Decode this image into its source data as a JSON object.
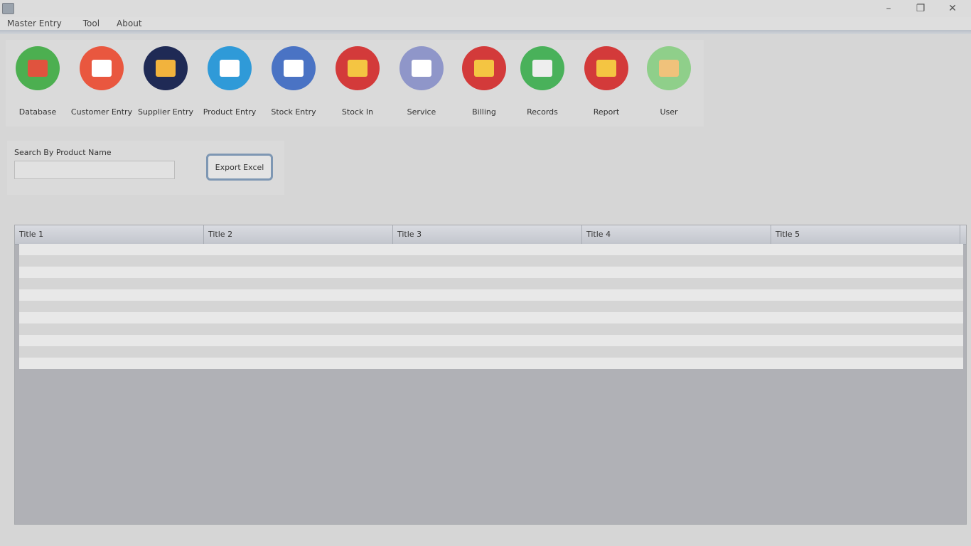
{
  "window": {
    "minimize_glyph": "–",
    "maximize_glyph": "❐",
    "close_glyph": "✕"
  },
  "menu": [
    "Master Entry",
    "Tool",
    "About"
  ],
  "toolbar": [
    {
      "label": "Database",
      "icon": "database-search-icon",
      "color": "#4caf50",
      "glyph_color": "#e0533e"
    },
    {
      "label": "Customer Entry",
      "icon": "customer-icon",
      "color": "#e9573f",
      "glyph_color": "#ffffff"
    },
    {
      "label": "Supplier Entry",
      "icon": "handshake-icon",
      "color": "#1f2a55",
      "glyph_color": "#f2b33d"
    },
    {
      "label": "Product Entry",
      "icon": "product-structure-icon",
      "color": "#2f9ad8",
      "glyph_color": "#ffffff"
    },
    {
      "label": "Stock Entry",
      "icon": "shopping-cart-icon",
      "color": "#4a73c4",
      "glyph_color": "#ffffff"
    },
    {
      "label": "Stock In",
      "icon": "laptop-icon",
      "color": "#d33a3a",
      "glyph_color": "#f4c542"
    },
    {
      "label": "Service",
      "icon": "tools-icon",
      "color": "#8f96c9",
      "glyph_color": "#ffffff"
    },
    {
      "label": "Billing",
      "icon": "laptop-icon",
      "color": "#d33a3a",
      "glyph_color": "#f4c542"
    },
    {
      "label": "Records",
      "icon": "book-icon",
      "color": "#49b15a",
      "glyph_color": "#eeeeee"
    },
    {
      "label": "Report",
      "icon": "laptop-icon",
      "color": "#d33a3a",
      "glyph_color": "#f4c542"
    },
    {
      "label": "User",
      "icon": "user-avatar-icon",
      "color": "#8fcf8a",
      "glyph_color": "#f0c27b"
    }
  ],
  "search": {
    "label": "Search By Product Name",
    "value": "",
    "export_label": "Export Excel"
  },
  "table": {
    "columns": [
      "Title 1",
      "Title 2",
      "Title 3",
      "Title 4",
      "Title 5"
    ],
    "rows": [
      [],
      [],
      [],
      [],
      [],
      [],
      [],
      [],
      [],
      [],
      []
    ]
  }
}
